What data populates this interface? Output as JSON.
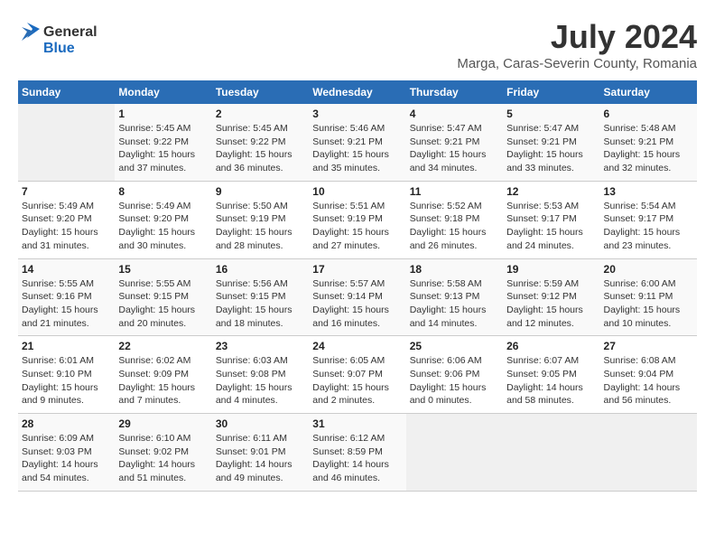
{
  "header": {
    "logo_general": "General",
    "logo_blue": "Blue",
    "title": "July 2024",
    "subtitle": "Marga, Caras-Severin County, Romania"
  },
  "calendar": {
    "days_of_week": [
      "Sunday",
      "Monday",
      "Tuesday",
      "Wednesday",
      "Thursday",
      "Friday",
      "Saturday"
    ],
    "weeks": [
      [
        {
          "day": "",
          "info": ""
        },
        {
          "day": "1",
          "info": "Sunrise: 5:45 AM\nSunset: 9:22 PM\nDaylight: 15 hours\nand 37 minutes."
        },
        {
          "day": "2",
          "info": "Sunrise: 5:45 AM\nSunset: 9:22 PM\nDaylight: 15 hours\nand 36 minutes."
        },
        {
          "day": "3",
          "info": "Sunrise: 5:46 AM\nSunset: 9:21 PM\nDaylight: 15 hours\nand 35 minutes."
        },
        {
          "day": "4",
          "info": "Sunrise: 5:47 AM\nSunset: 9:21 PM\nDaylight: 15 hours\nand 34 minutes."
        },
        {
          "day": "5",
          "info": "Sunrise: 5:47 AM\nSunset: 9:21 PM\nDaylight: 15 hours\nand 33 minutes."
        },
        {
          "day": "6",
          "info": "Sunrise: 5:48 AM\nSunset: 9:21 PM\nDaylight: 15 hours\nand 32 minutes."
        }
      ],
      [
        {
          "day": "7",
          "info": "Sunrise: 5:49 AM\nSunset: 9:20 PM\nDaylight: 15 hours\nand 31 minutes."
        },
        {
          "day": "8",
          "info": "Sunrise: 5:49 AM\nSunset: 9:20 PM\nDaylight: 15 hours\nand 30 minutes."
        },
        {
          "day": "9",
          "info": "Sunrise: 5:50 AM\nSunset: 9:19 PM\nDaylight: 15 hours\nand 28 minutes."
        },
        {
          "day": "10",
          "info": "Sunrise: 5:51 AM\nSunset: 9:19 PM\nDaylight: 15 hours\nand 27 minutes."
        },
        {
          "day": "11",
          "info": "Sunrise: 5:52 AM\nSunset: 9:18 PM\nDaylight: 15 hours\nand 26 minutes."
        },
        {
          "day": "12",
          "info": "Sunrise: 5:53 AM\nSunset: 9:17 PM\nDaylight: 15 hours\nand 24 minutes."
        },
        {
          "day": "13",
          "info": "Sunrise: 5:54 AM\nSunset: 9:17 PM\nDaylight: 15 hours\nand 23 minutes."
        }
      ],
      [
        {
          "day": "14",
          "info": "Sunrise: 5:55 AM\nSunset: 9:16 PM\nDaylight: 15 hours\nand 21 minutes."
        },
        {
          "day": "15",
          "info": "Sunrise: 5:55 AM\nSunset: 9:15 PM\nDaylight: 15 hours\nand 20 minutes."
        },
        {
          "day": "16",
          "info": "Sunrise: 5:56 AM\nSunset: 9:15 PM\nDaylight: 15 hours\nand 18 minutes."
        },
        {
          "day": "17",
          "info": "Sunrise: 5:57 AM\nSunset: 9:14 PM\nDaylight: 15 hours\nand 16 minutes."
        },
        {
          "day": "18",
          "info": "Sunrise: 5:58 AM\nSunset: 9:13 PM\nDaylight: 15 hours\nand 14 minutes."
        },
        {
          "day": "19",
          "info": "Sunrise: 5:59 AM\nSunset: 9:12 PM\nDaylight: 15 hours\nand 12 minutes."
        },
        {
          "day": "20",
          "info": "Sunrise: 6:00 AM\nSunset: 9:11 PM\nDaylight: 15 hours\nand 10 minutes."
        }
      ],
      [
        {
          "day": "21",
          "info": "Sunrise: 6:01 AM\nSunset: 9:10 PM\nDaylight: 15 hours\nand 9 minutes."
        },
        {
          "day": "22",
          "info": "Sunrise: 6:02 AM\nSunset: 9:09 PM\nDaylight: 15 hours\nand 7 minutes."
        },
        {
          "day": "23",
          "info": "Sunrise: 6:03 AM\nSunset: 9:08 PM\nDaylight: 15 hours\nand 4 minutes."
        },
        {
          "day": "24",
          "info": "Sunrise: 6:05 AM\nSunset: 9:07 PM\nDaylight: 15 hours\nand 2 minutes."
        },
        {
          "day": "25",
          "info": "Sunrise: 6:06 AM\nSunset: 9:06 PM\nDaylight: 15 hours\nand 0 minutes."
        },
        {
          "day": "26",
          "info": "Sunrise: 6:07 AM\nSunset: 9:05 PM\nDaylight: 14 hours\nand 58 minutes."
        },
        {
          "day": "27",
          "info": "Sunrise: 6:08 AM\nSunset: 9:04 PM\nDaylight: 14 hours\nand 56 minutes."
        }
      ],
      [
        {
          "day": "28",
          "info": "Sunrise: 6:09 AM\nSunset: 9:03 PM\nDaylight: 14 hours\nand 54 minutes."
        },
        {
          "day": "29",
          "info": "Sunrise: 6:10 AM\nSunset: 9:02 PM\nDaylight: 14 hours\nand 51 minutes."
        },
        {
          "day": "30",
          "info": "Sunrise: 6:11 AM\nSunset: 9:01 PM\nDaylight: 14 hours\nand 49 minutes."
        },
        {
          "day": "31",
          "info": "Sunrise: 6:12 AM\nSunset: 8:59 PM\nDaylight: 14 hours\nand 46 minutes."
        },
        {
          "day": "",
          "info": ""
        },
        {
          "day": "",
          "info": ""
        },
        {
          "day": "",
          "info": ""
        }
      ]
    ]
  }
}
